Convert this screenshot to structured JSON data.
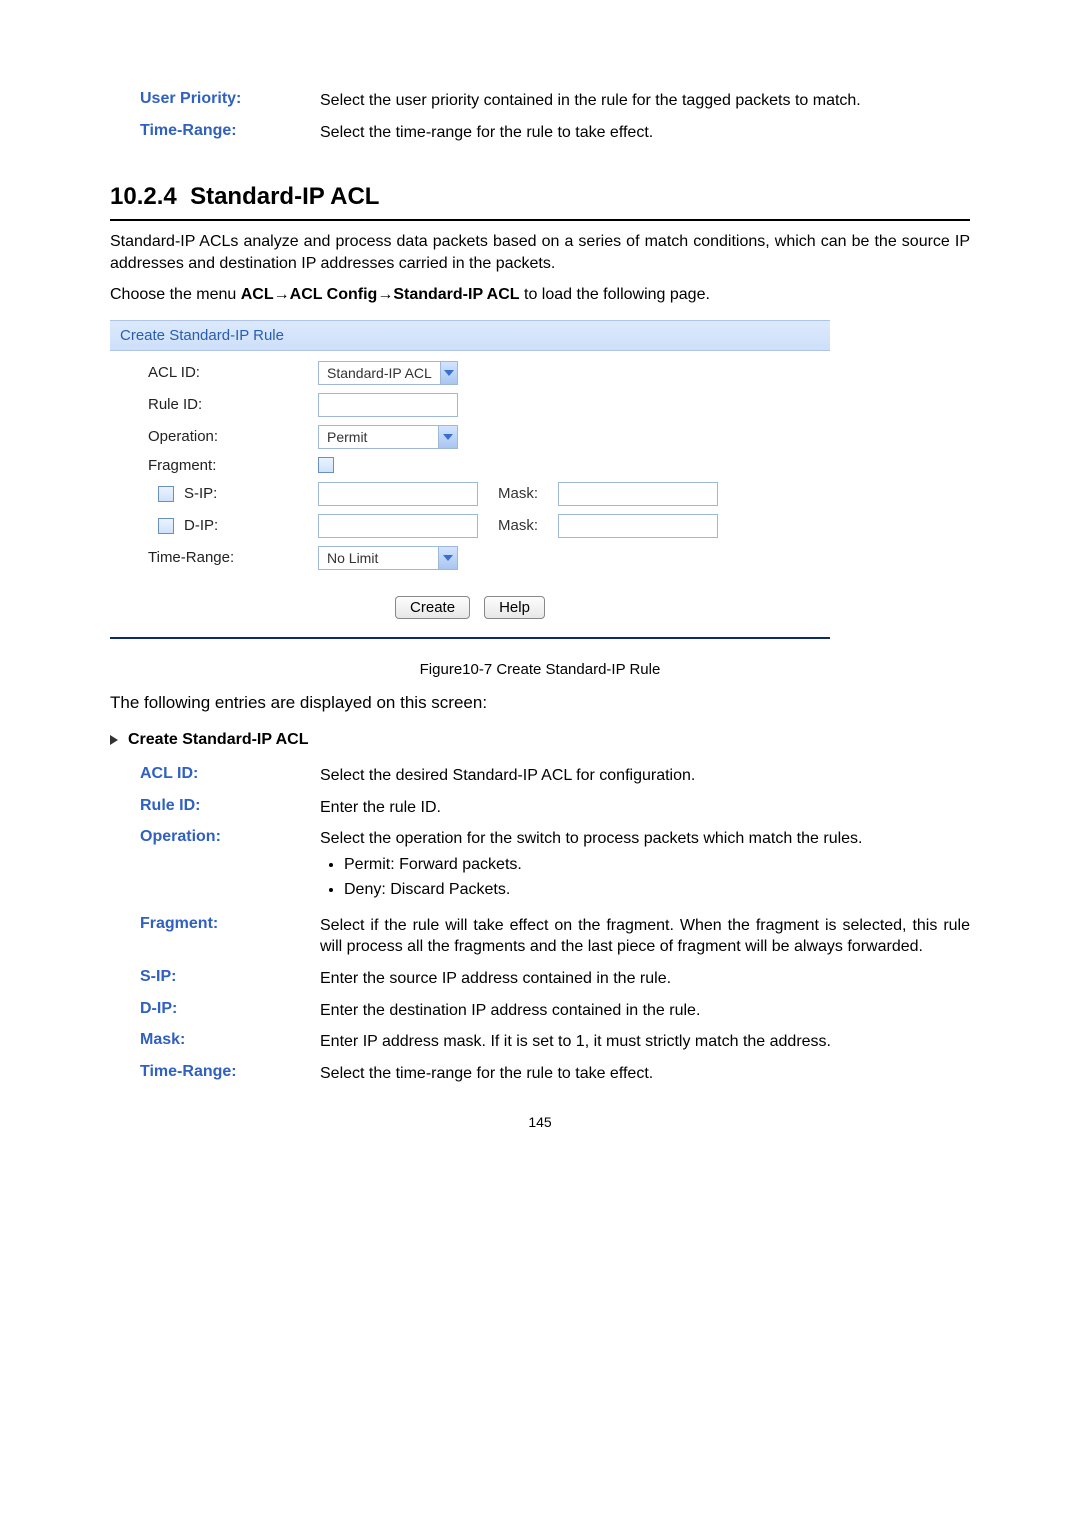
{
  "top_defs": [
    {
      "label": "User Priority:",
      "value": "Select the user priority contained in the rule for the tagged packets to match."
    },
    {
      "label": "Time-Range:",
      "value": "Select the time-range for the rule to take effect."
    }
  ],
  "section": {
    "number": "10.2.4",
    "title": "Standard-IP ACL",
    "intro1": "Standard-IP ACLs analyze and process data packets based on a series of match conditions, which can be the source IP addresses and destination IP addresses carried in the packets.",
    "intro2_prefix": "Choose the menu ",
    "intro2_bold": "ACL→ACL Config→Standard-IP ACL",
    "intro2_suffix": " to load the following page."
  },
  "panel": {
    "title": "Create Standard-IP Rule",
    "labels": {
      "acl_id": "ACL ID:",
      "rule_id": "Rule ID:",
      "operation": "Operation:",
      "fragment": "Fragment:",
      "sip": "S-IP:",
      "dip": "D-IP:",
      "mask": "Mask:",
      "time_range": "Time-Range:"
    },
    "dropdowns": {
      "acl_id": "Standard-IP ACL",
      "operation": "Permit",
      "time_range": "No Limit"
    },
    "buttons": {
      "create": "Create",
      "help": "Help"
    }
  },
  "figure_caption": "Figure10-7 Create Standard-IP Rule",
  "entries_intro": "The following entries are displayed on this screen:",
  "sub_heading": "Create Standard-IP ACL",
  "defs": {
    "acl_id": {
      "label": "ACL ID:",
      "value": "Select the desired Standard-IP ACL for configuration."
    },
    "rule_id": {
      "label": "Rule ID:",
      "value": "Enter the rule ID."
    },
    "operation": {
      "label": "Operation:",
      "value": "Select the operation for the switch to process packets which match the rules.",
      "bullets": [
        "Permit: Forward packets.",
        "Deny: Discard Packets."
      ]
    },
    "fragment": {
      "label": "Fragment:",
      "value": "Select if the rule will take effect on the fragment. When the fragment is selected, this rule will process all the fragments and the last piece of fragment will be always forwarded."
    },
    "sip": {
      "label": "S-IP:",
      "value": "Enter the source IP address contained in the rule."
    },
    "dip": {
      "label": "D-IP:",
      "value": "Enter the destination IP address contained in the rule."
    },
    "mask": {
      "label": "Mask:",
      "value": "Enter IP address mask. If it is set to 1, it must strictly match the address."
    },
    "time_range": {
      "label": "Time-Range:",
      "value": "Select the time-range for the rule to take effect."
    }
  },
  "page_number": "145"
}
